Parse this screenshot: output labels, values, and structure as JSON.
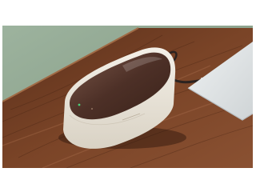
{
  "photo": {
    "subject": "product-photo",
    "device_brand_text": "",
    "colors": {
      "wall": "#8fa790",
      "wood_dark": "#4a2717",
      "wood_mid": "#6b3a22",
      "wood_light": "#8c5434",
      "device_body": "#ece7dd",
      "device_lid": "#5a3a2f",
      "laptop": "#dfe3e4",
      "cable": "#2c2320"
    }
  }
}
